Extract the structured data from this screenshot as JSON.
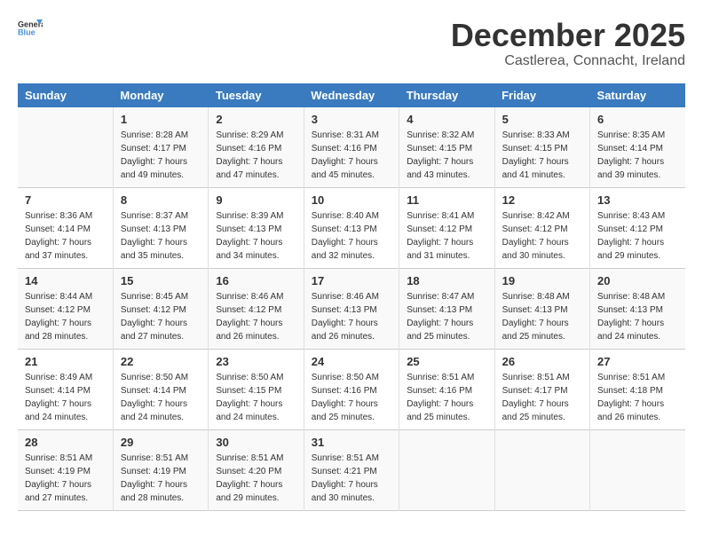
{
  "logo": {
    "general": "General",
    "blue": "Blue"
  },
  "header": {
    "month": "December 2025",
    "location": "Castlerea, Connacht, Ireland"
  },
  "days_of_week": [
    "Sunday",
    "Monday",
    "Tuesday",
    "Wednesday",
    "Thursday",
    "Friday",
    "Saturday"
  ],
  "weeks": [
    [
      {
        "day": "",
        "info": ""
      },
      {
        "day": "1",
        "info": "Sunrise: 8:28 AM\nSunset: 4:17 PM\nDaylight: 7 hours\nand 49 minutes."
      },
      {
        "day": "2",
        "info": "Sunrise: 8:29 AM\nSunset: 4:16 PM\nDaylight: 7 hours\nand 47 minutes."
      },
      {
        "day": "3",
        "info": "Sunrise: 8:31 AM\nSunset: 4:16 PM\nDaylight: 7 hours\nand 45 minutes."
      },
      {
        "day": "4",
        "info": "Sunrise: 8:32 AM\nSunset: 4:15 PM\nDaylight: 7 hours\nand 43 minutes."
      },
      {
        "day": "5",
        "info": "Sunrise: 8:33 AM\nSunset: 4:15 PM\nDaylight: 7 hours\nand 41 minutes."
      },
      {
        "day": "6",
        "info": "Sunrise: 8:35 AM\nSunset: 4:14 PM\nDaylight: 7 hours\nand 39 minutes."
      }
    ],
    [
      {
        "day": "7",
        "info": "Sunrise: 8:36 AM\nSunset: 4:14 PM\nDaylight: 7 hours\nand 37 minutes."
      },
      {
        "day": "8",
        "info": "Sunrise: 8:37 AM\nSunset: 4:13 PM\nDaylight: 7 hours\nand 35 minutes."
      },
      {
        "day": "9",
        "info": "Sunrise: 8:39 AM\nSunset: 4:13 PM\nDaylight: 7 hours\nand 34 minutes."
      },
      {
        "day": "10",
        "info": "Sunrise: 8:40 AM\nSunset: 4:13 PM\nDaylight: 7 hours\nand 32 minutes."
      },
      {
        "day": "11",
        "info": "Sunrise: 8:41 AM\nSunset: 4:12 PM\nDaylight: 7 hours\nand 31 minutes."
      },
      {
        "day": "12",
        "info": "Sunrise: 8:42 AM\nSunset: 4:12 PM\nDaylight: 7 hours\nand 30 minutes."
      },
      {
        "day": "13",
        "info": "Sunrise: 8:43 AM\nSunset: 4:12 PM\nDaylight: 7 hours\nand 29 minutes."
      }
    ],
    [
      {
        "day": "14",
        "info": "Sunrise: 8:44 AM\nSunset: 4:12 PM\nDaylight: 7 hours\nand 28 minutes."
      },
      {
        "day": "15",
        "info": "Sunrise: 8:45 AM\nSunset: 4:12 PM\nDaylight: 7 hours\nand 27 minutes."
      },
      {
        "day": "16",
        "info": "Sunrise: 8:46 AM\nSunset: 4:12 PM\nDaylight: 7 hours\nand 26 minutes."
      },
      {
        "day": "17",
        "info": "Sunrise: 8:46 AM\nSunset: 4:13 PM\nDaylight: 7 hours\nand 26 minutes."
      },
      {
        "day": "18",
        "info": "Sunrise: 8:47 AM\nSunset: 4:13 PM\nDaylight: 7 hours\nand 25 minutes."
      },
      {
        "day": "19",
        "info": "Sunrise: 8:48 AM\nSunset: 4:13 PM\nDaylight: 7 hours\nand 25 minutes."
      },
      {
        "day": "20",
        "info": "Sunrise: 8:48 AM\nSunset: 4:13 PM\nDaylight: 7 hours\nand 24 minutes."
      }
    ],
    [
      {
        "day": "21",
        "info": "Sunrise: 8:49 AM\nSunset: 4:14 PM\nDaylight: 7 hours\nand 24 minutes."
      },
      {
        "day": "22",
        "info": "Sunrise: 8:50 AM\nSunset: 4:14 PM\nDaylight: 7 hours\nand 24 minutes."
      },
      {
        "day": "23",
        "info": "Sunrise: 8:50 AM\nSunset: 4:15 PM\nDaylight: 7 hours\nand 24 minutes."
      },
      {
        "day": "24",
        "info": "Sunrise: 8:50 AM\nSunset: 4:16 PM\nDaylight: 7 hours\nand 25 minutes."
      },
      {
        "day": "25",
        "info": "Sunrise: 8:51 AM\nSunset: 4:16 PM\nDaylight: 7 hours\nand 25 minutes."
      },
      {
        "day": "26",
        "info": "Sunrise: 8:51 AM\nSunset: 4:17 PM\nDaylight: 7 hours\nand 25 minutes."
      },
      {
        "day": "27",
        "info": "Sunrise: 8:51 AM\nSunset: 4:18 PM\nDaylight: 7 hours\nand 26 minutes."
      }
    ],
    [
      {
        "day": "28",
        "info": "Sunrise: 8:51 AM\nSunset: 4:19 PM\nDaylight: 7 hours\nand 27 minutes."
      },
      {
        "day": "29",
        "info": "Sunrise: 8:51 AM\nSunset: 4:19 PM\nDaylight: 7 hours\nand 28 minutes."
      },
      {
        "day": "30",
        "info": "Sunrise: 8:51 AM\nSunset: 4:20 PM\nDaylight: 7 hours\nand 29 minutes."
      },
      {
        "day": "31",
        "info": "Sunrise: 8:51 AM\nSunset: 4:21 PM\nDaylight: 7 hours\nand 30 minutes."
      },
      {
        "day": "",
        "info": ""
      },
      {
        "day": "",
        "info": ""
      },
      {
        "day": "",
        "info": ""
      }
    ]
  ]
}
